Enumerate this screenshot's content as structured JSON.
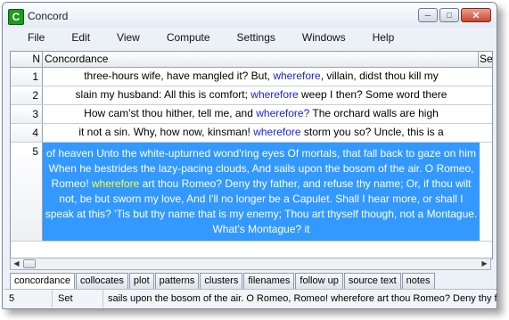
{
  "window": {
    "title": "Concord",
    "icon_letter": "C"
  },
  "menu": [
    "File",
    "Edit",
    "View",
    "Compute",
    "Settings",
    "Windows",
    "Help"
  ],
  "grid": {
    "headers": {
      "n": "N",
      "concordance": "Concordance",
      "set": "Se"
    },
    "rows": [
      {
        "n": "1",
        "pre": "three-hours wife, have mangled it? But, ",
        "kw": "wherefore",
        "post": ", villain, didst thou kill my"
      },
      {
        "n": "2",
        "pre": "slain my husband: All this is comfort; ",
        "kw": "wherefore",
        "post": " weep I then? Some word there"
      },
      {
        "n": "3",
        "pre": "How cam'st thou hither, tell me, and ",
        "kw": "wherefore?",
        "post": " The orchard walls are high"
      },
      {
        "n": "4",
        "pre": "it not a sin.  Why, how now, kinsman! ",
        "kw": "wherefore",
        "post": " storm you so?  Uncle, this is a"
      }
    ],
    "selected": {
      "n": "5",
      "pre": "of heaven Unto the white-upturned wond'ring eyes Of mortals, that fall back to gaze on him When he bestrides the lazy-pacing clouds, And sails upon the bosom of the air.  O Romeo, Romeo! ",
      "kw": "wherefore",
      "post": " art thou Romeo? Deny thy father, and refuse thy name; Or, if thou wilt not, be but sworn my love, And I'll no longer be a Capulet. Shall I hear more, or shall I speak at this?  'Tis but thy name that is my enemy; Thou art thyself though, not a Montague. What's Montague? it"
    }
  },
  "tabs": [
    "concordance",
    "collocates",
    "plot",
    "patterns",
    "clusters",
    "filenames",
    "follow up",
    "source text",
    "notes"
  ],
  "status": {
    "row": "5",
    "set": "Set",
    "text": "sails upon the bosom of the air.  O Romeo, Romeo! wherefore art thou Romeo? Deny thy fa"
  }
}
